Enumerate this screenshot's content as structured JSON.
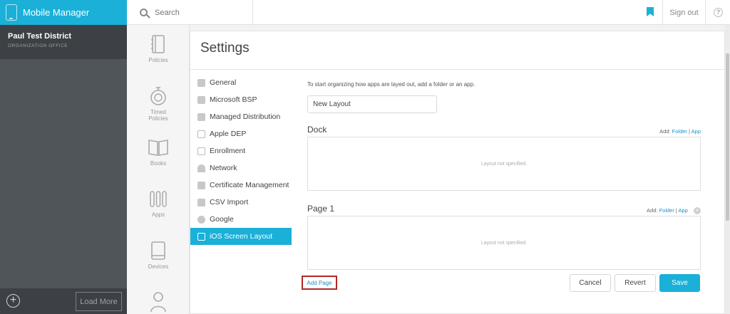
{
  "app": {
    "title": "Mobile Manager"
  },
  "search": {
    "placeholder": "Search"
  },
  "header": {
    "sign_out": "Sign out",
    "help": "?"
  },
  "org": {
    "name": "Paul Test District",
    "subtitle": "ORGANIZATION OFFICE",
    "load_more": "Load More",
    "add": "+"
  },
  "nav": {
    "policies": "Policies",
    "timed_1": "Timed",
    "timed_2": "Policies",
    "books": "Books",
    "apps": "Apps",
    "devices": "Devices"
  },
  "page": {
    "title": "Settings"
  },
  "menu": [
    {
      "label": "General",
      "icon": "gear-icon"
    },
    {
      "label": "Microsoft BSP",
      "icon": "windows-icon"
    },
    {
      "label": "Managed Distribution",
      "icon": "distribution-icon"
    },
    {
      "label": "Apple DEP",
      "icon": "tablet-icon"
    },
    {
      "label": "Enrollment",
      "icon": "tablet-icon"
    },
    {
      "label": "Network",
      "icon": "wifi-icon"
    },
    {
      "label": "Certificate Management",
      "icon": "key-icon"
    },
    {
      "label": "CSV Import",
      "icon": "edit-icon"
    },
    {
      "label": "Google",
      "icon": "google-icon"
    },
    {
      "label": "iOS Screen Layout",
      "icon": "tablet-icon",
      "active": true
    }
  ],
  "layout": {
    "intro": "To start organizing how apps are layed out, add a folder or an app.",
    "name_value": "New Layout",
    "add_label": "Add:",
    "folder_link": "Folder",
    "separator": "|",
    "app_link": "App",
    "dock": {
      "title": "Dock",
      "empty": "Layout not specified."
    },
    "page1": {
      "title": "Page 1",
      "empty": "Layout not specified."
    }
  },
  "actions": {
    "add_page": "Add Page",
    "cancel": "Cancel",
    "revert": "Revert",
    "save": "Save"
  },
  "colors": {
    "accent": "#1ab0d8",
    "highlight_border": "#b52626"
  }
}
